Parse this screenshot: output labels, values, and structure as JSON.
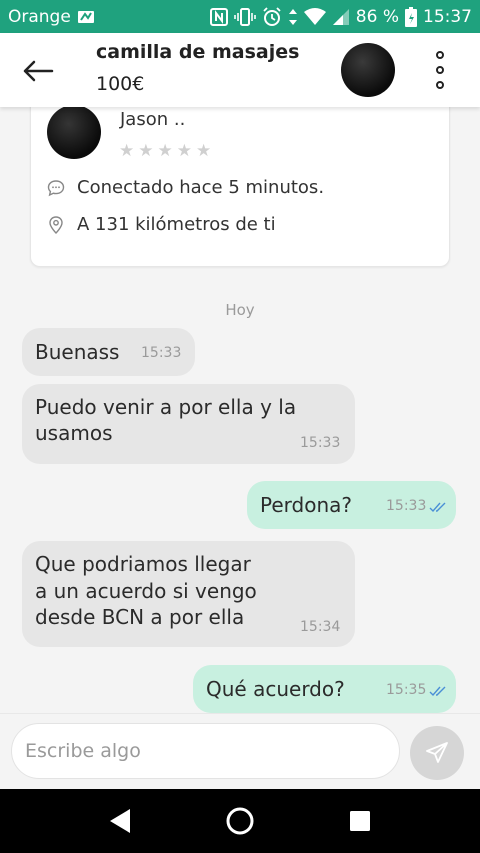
{
  "status_bar": {
    "carrier": "Orange",
    "battery_percent": "86 %",
    "time": "15:37",
    "icons": [
      "app-notification-icon",
      "nfc-icon",
      "vibrate-icon",
      "alarm-icon",
      "data-arrows-icon",
      "wifi-icon",
      "signal-icon",
      "battery-icon"
    ]
  },
  "header": {
    "title": "camilla de masajes",
    "price": "100€"
  },
  "profile": {
    "name": "Jason ..",
    "rating_stars": 0,
    "max_stars": 5,
    "last_seen": "Conectado hace 5 minutos.",
    "distance": "A 131 kilómetros de ti"
  },
  "day_separator": "Hoy",
  "messages": [
    {
      "direction": "in",
      "text": "Buenass",
      "time": "15:33"
    },
    {
      "direction": "in",
      "text_lines": [
        "Puedo venir a por ella y la",
        "usamos"
      ],
      "time": "15:33"
    },
    {
      "direction": "out",
      "text": "Perdona?",
      "time": "15:33",
      "status": "read"
    },
    {
      "direction": "in",
      "text_lines": [
        "Que podriamos llegar",
        "a un acuerdo si vengo",
        "desde BCN a por ella"
      ],
      "time": "15:34"
    },
    {
      "direction": "out",
      "text": "Qué acuerdo?",
      "time": "15:35",
      "status": "read"
    }
  ],
  "composer": {
    "placeholder": "Escribe algo"
  },
  "colors": {
    "brand": "#1fa27e",
    "outgoing_bubble": "#c8f0e0",
    "incoming_bubble": "#e6e6e6",
    "read_ticks": "#4a8fd6"
  }
}
